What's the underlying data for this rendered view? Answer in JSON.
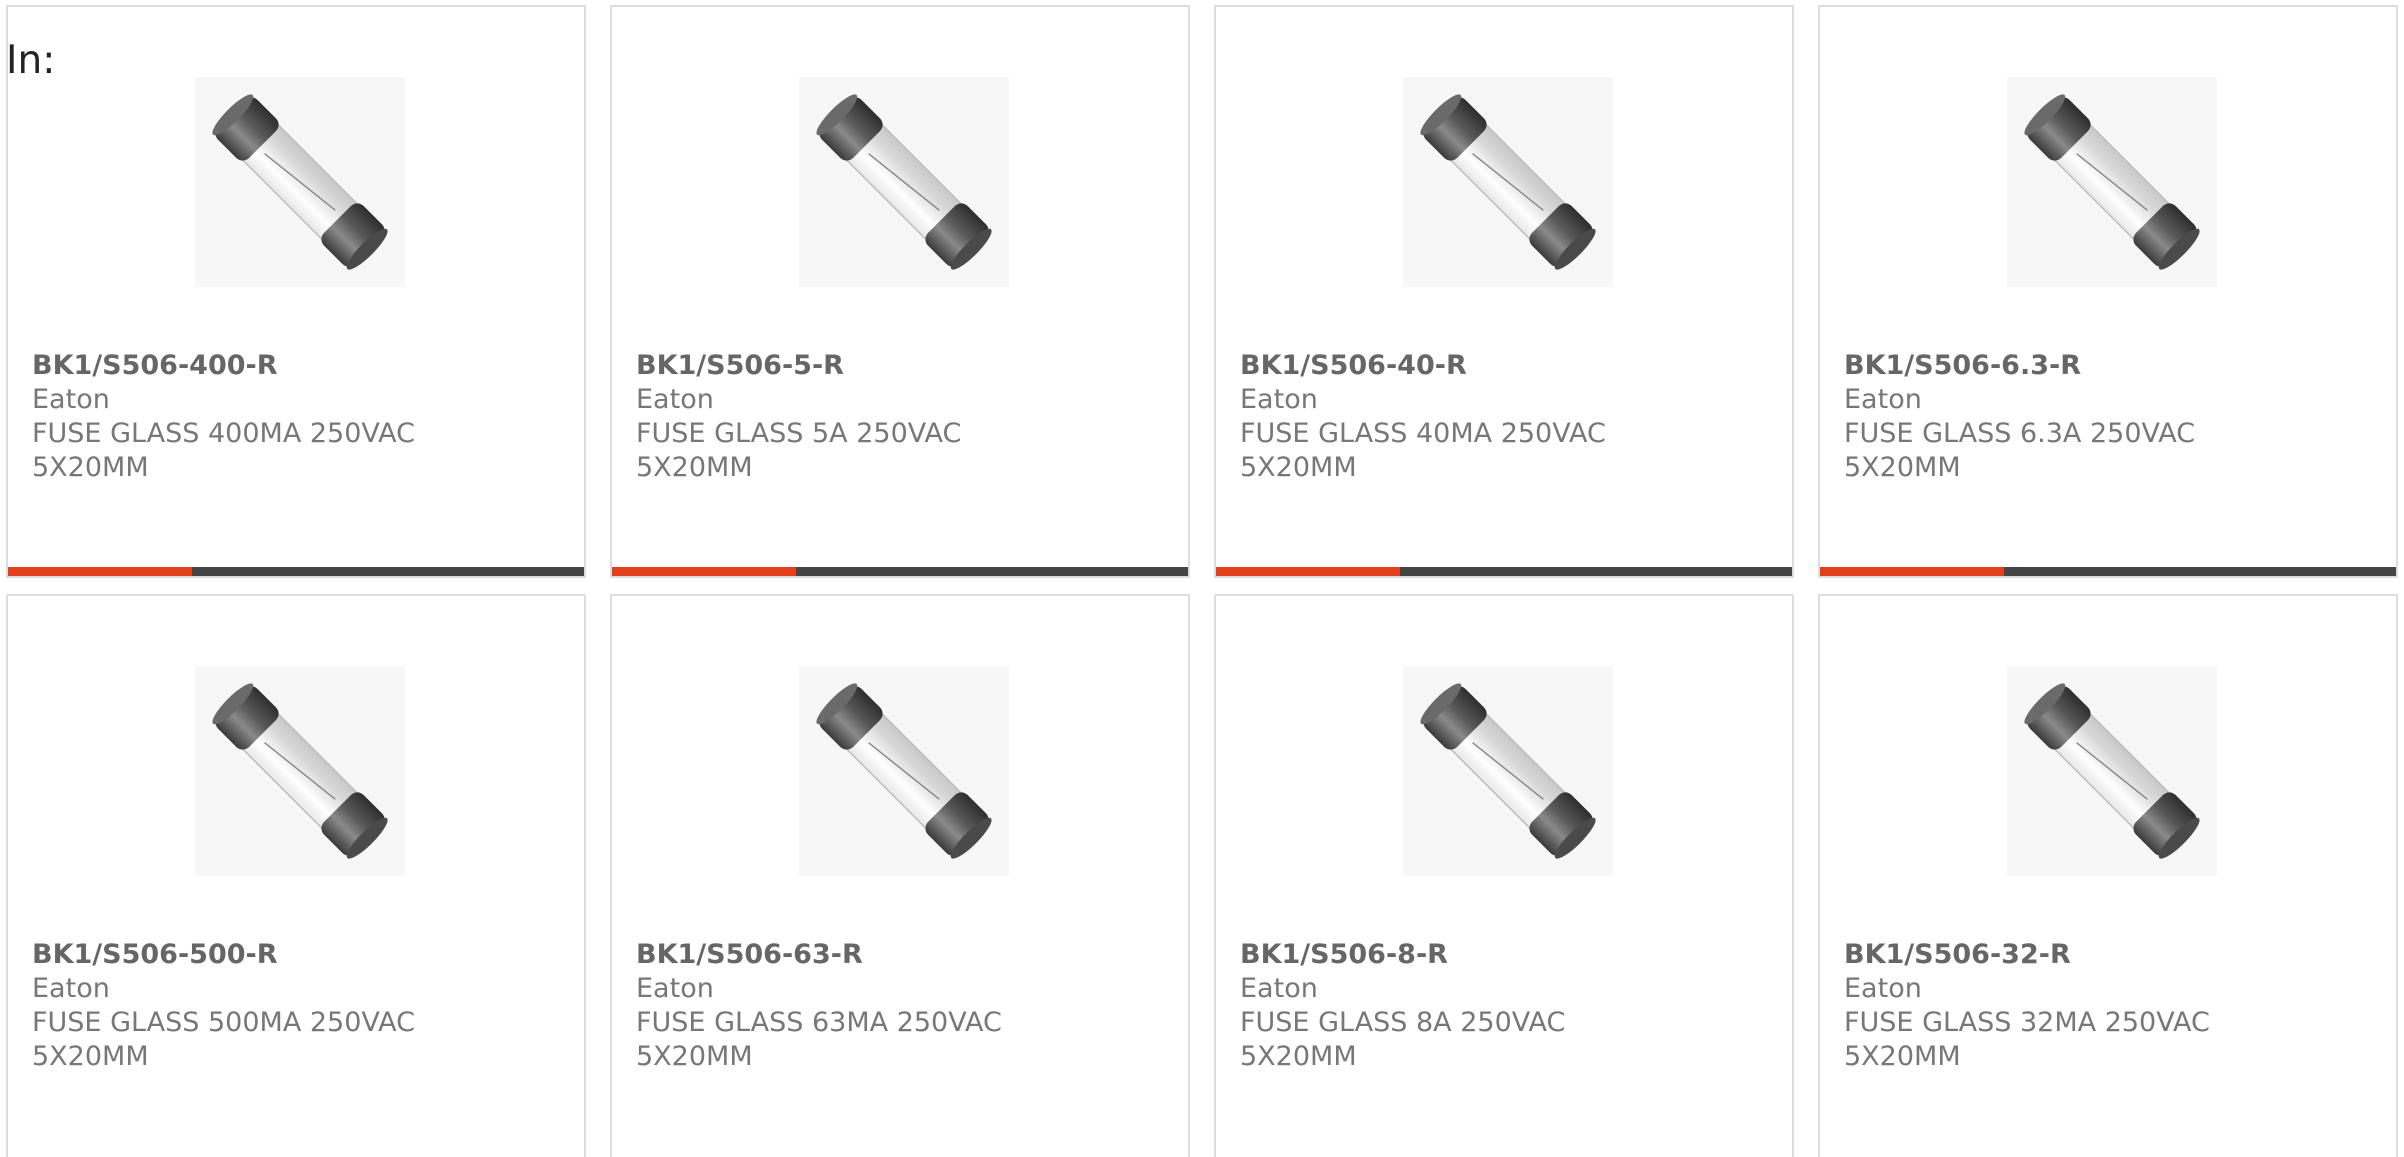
{
  "prefix_label": "In:",
  "colors": {
    "accent": "#e2401c",
    "bar": "#444444",
    "border": "#dddddd",
    "text": "#777777"
  },
  "image_icon": "glass-fuse-product-photo",
  "products": [
    {
      "part_number": "BK1/S506-400-R",
      "manufacturer": "Eaton",
      "description": "FUSE GLASS 400MA 250VAC 5X20MM"
    },
    {
      "part_number": "BK1/S506-5-R",
      "manufacturer": "Eaton",
      "description": "FUSE GLASS 5A 250VAC 5X20MM"
    },
    {
      "part_number": "BK1/S506-40-R",
      "manufacturer": "Eaton",
      "description": "FUSE GLASS 40MA 250VAC 5X20MM"
    },
    {
      "part_number": "BK1/S506-6.3-R",
      "manufacturer": "Eaton",
      "description": "FUSE GLASS 6.3A 250VAC 5X20MM"
    },
    {
      "part_number": "BK1/S506-500-R",
      "manufacturer": "Eaton",
      "description": "FUSE GLASS 500MA 250VAC 5X20MM"
    },
    {
      "part_number": "BK1/S506-63-R",
      "manufacturer": "Eaton",
      "description": "FUSE GLASS 63MA 250VAC 5X20MM"
    },
    {
      "part_number": "BK1/S506-8-R",
      "manufacturer": "Eaton",
      "description": "FUSE GLASS 8A 250VAC 5X20MM"
    },
    {
      "part_number": "BK1/S506-32-R",
      "manufacturer": "Eaton",
      "description": "FUSE GLASS 32MA 250VAC 5X20MM"
    }
  ]
}
